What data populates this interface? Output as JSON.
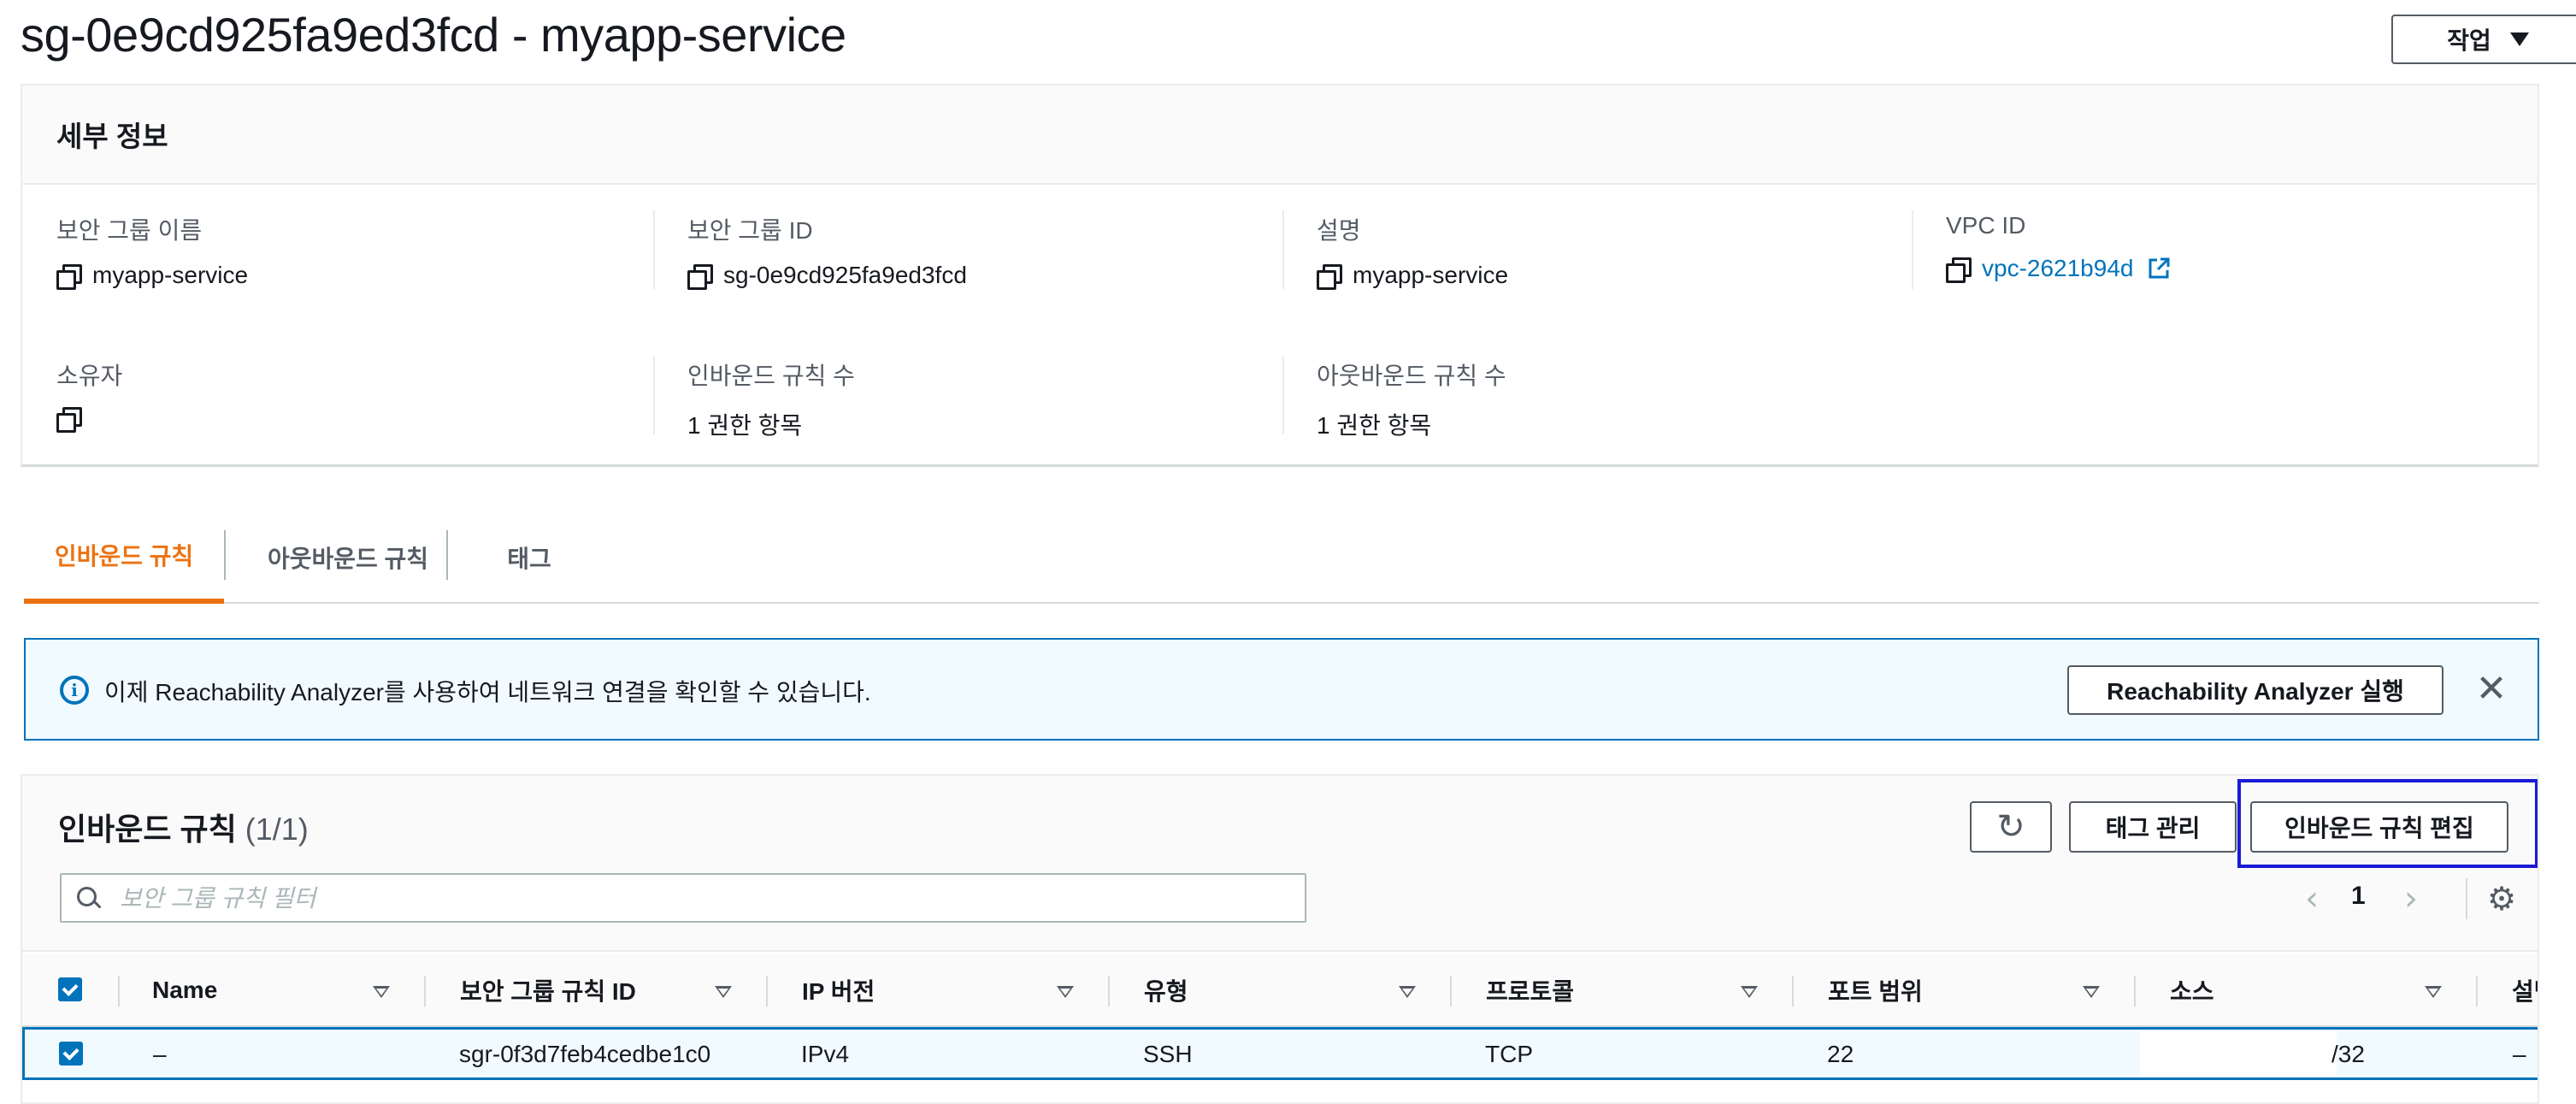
{
  "page": {
    "title": "sg-0e9cd925fa9ed3fcd - myapp-service",
    "action_button": "작업"
  },
  "details": {
    "header": "세부 정보",
    "fields": [
      {
        "label": "보안 그룹 이름",
        "value": "myapp-service"
      },
      {
        "label": "보안 그룹 ID",
        "value": "sg-0e9cd925fa9ed3fcd"
      },
      {
        "label": "설명",
        "value": "myapp-service"
      },
      {
        "label": "VPC ID",
        "value": "vpc-2621b94d"
      },
      {
        "label": "소유자",
        "value": ""
      },
      {
        "label": "인바운드 규칙 수",
        "value": "1 권한 항목"
      },
      {
        "label": "아웃바운드 규칙 수",
        "value": "1 권한 항목"
      }
    ]
  },
  "tabs": [
    {
      "label": "인바운드 규칙",
      "active": true
    },
    {
      "label": "아웃바운드 규칙",
      "active": false
    },
    {
      "label": "태그",
      "active": false
    }
  ],
  "flash": {
    "message": "이제 Reachability Analyzer를 사용하여 네트워크 연결을 확인할 수 있습니다.",
    "button": "Reachability Analyzer 실행",
    "close": "✕"
  },
  "rules": {
    "title": "인바운드 규칙",
    "count": "(1/1)",
    "manage_tags_button": "태그 관리",
    "edit_button": "인바운드 규칙 편집",
    "filter_placeholder": "보안 그룹 규칙 필터",
    "page": "1",
    "columns": [
      "Name",
      "보안 그룹 규칙 ID",
      "IP 버전",
      "유형",
      "프로토콜",
      "포트 범위",
      "소스",
      "설명"
    ],
    "rows": [
      {
        "name": "–",
        "rule_id": "sgr-0f3d7feb4cedbe1c0",
        "ip_version": "IPv4",
        "type": "SSH",
        "protocol": "TCP",
        "port_range": "22",
        "source": "/32",
        "description": "–"
      }
    ]
  },
  "colors": {
    "accent": "#ec7211",
    "link": "#0073bb",
    "highlight_box": "#1a1ad6"
  },
  "icons": [
    "copy-icon",
    "external-link-icon",
    "info-icon",
    "close-icon",
    "refresh-icon",
    "search-icon",
    "chevron-left-icon",
    "chevron-right-icon",
    "gear-icon",
    "sort-caret-icon",
    "checkbox-checked-icon",
    "caret-down-icon"
  ]
}
